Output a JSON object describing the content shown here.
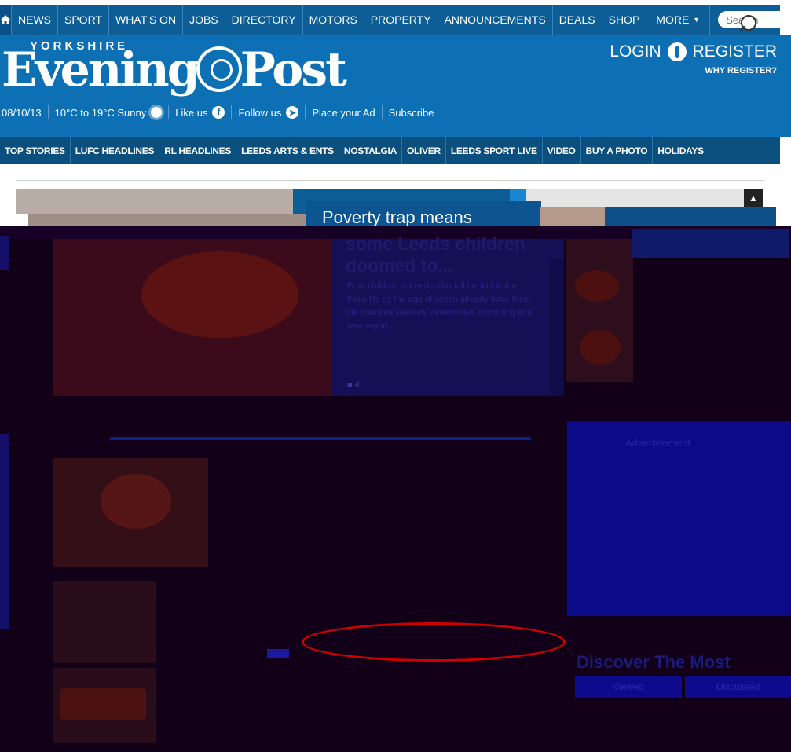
{
  "topnav": {
    "items": [
      "NEWS",
      "SPORT",
      "WHAT'S ON",
      "JOBS",
      "DIRECTORY",
      "MOTORS",
      "PROPERTY",
      "ANNOUNCEMENTS",
      "DEALS",
      "SHOP"
    ],
    "more": "MORE",
    "search_placeholder": "Search"
  },
  "masthead": {
    "logo_top": "YORKSHIRE",
    "logo_left": "Evening",
    "logo_right": "Post",
    "login": "LOGIN",
    "register": "REGISTER",
    "why_register": "WHY REGISTER?",
    "date": "08/10/13",
    "weather": "10°C to 19°C Sunny",
    "like_us": "Like us",
    "follow_us": "Follow us",
    "place_ad": "Place your Ad",
    "subscribe": "Subscribe"
  },
  "section_nav": [
    "TOP STORIES",
    "LUFC HEADLINES",
    "RL HEADLINES",
    "LEEDS ARTS & ENTS",
    "NOSTALGIA",
    "OLIVER",
    "LEEDS SPORT LIVE",
    "VIDEO",
    "BUY A PHOTO",
    "HOLIDAYS"
  ],
  "hero": {
    "title_line1": "Poverty trap means",
    "title_rest": "some Leeds children doomed to...",
    "summary": "Poor children in Leeds who fall behind in the three Rs by the age of seven already have their life chances severely determined, according to a new report.",
    "comment_count": "4"
  },
  "ad_label": "Advertisement",
  "discover": {
    "title": "Discover The Most",
    "tab_viewed": "Viewed",
    "tab_discussed": "Discussed"
  },
  "colors": {
    "nav_blue": "#0d5d97",
    "brand_blue": "#0d70b5",
    "section_nav": "#0b4f7e",
    "ellipse_red": "#cf0000"
  }
}
